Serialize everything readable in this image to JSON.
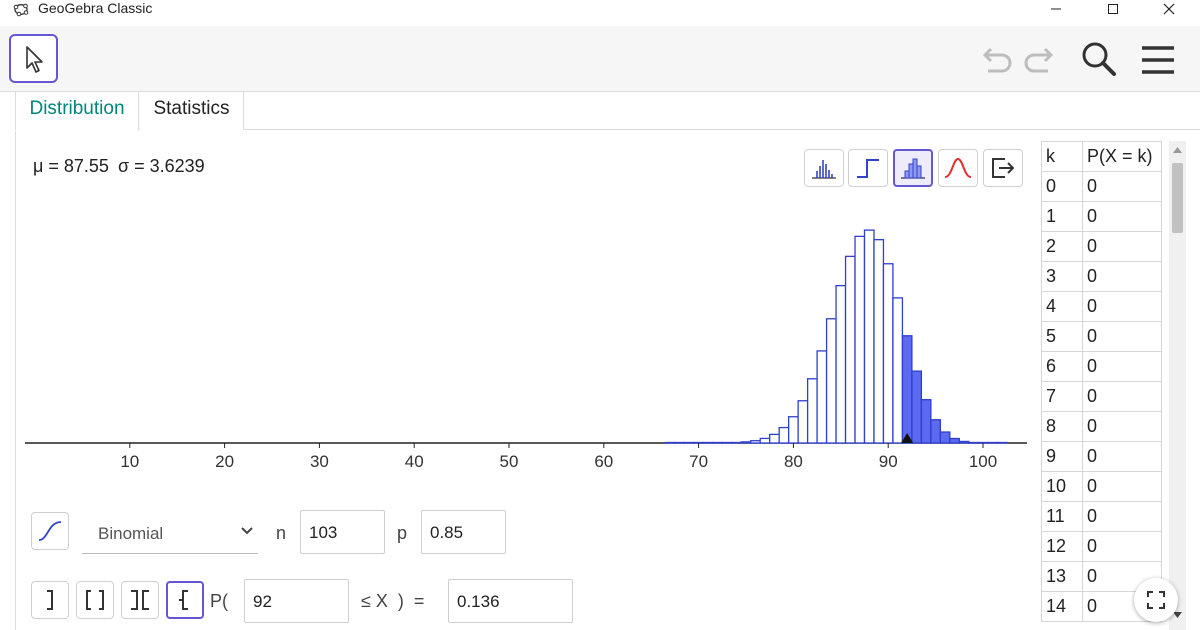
{
  "window": {
    "title": "GeoGebra Classic"
  },
  "tabs": [
    {
      "label": "Distribution",
      "active": true
    },
    {
      "label": "Statistics",
      "active": false
    }
  ],
  "stats": {
    "mean": "μ = 87.55",
    "sd": "σ = 3.6239"
  },
  "distribution": {
    "selected": "Binomial",
    "n_label": "n",
    "n_value": "103",
    "p_label": "p",
    "p_value": "0.85"
  },
  "probability": {
    "prefix": "P(",
    "bound": "92",
    "relation": "≤ X  )  =",
    "result": "0.136"
  },
  "table": {
    "headers": [
      "k",
      "P(X = k)"
    ],
    "rows": [
      [
        "0",
        "0"
      ],
      [
        "1",
        "0"
      ],
      [
        "2",
        "0"
      ],
      [
        "3",
        "0"
      ],
      [
        "4",
        "0"
      ],
      [
        "5",
        "0"
      ],
      [
        "6",
        "0"
      ],
      [
        "7",
        "0"
      ],
      [
        "8",
        "0"
      ],
      [
        "9",
        "0"
      ],
      [
        "10",
        "0"
      ],
      [
        "11",
        "0"
      ],
      [
        "12",
        "0"
      ],
      [
        "13",
        "0"
      ],
      [
        "14",
        "0"
      ]
    ]
  },
  "colors": {
    "accent": "#6557d2",
    "bar": "#2f3fd0",
    "bar_fill": "#5b6af0",
    "tab_active": "#00867a"
  },
  "chart_data": {
    "type": "bar",
    "x_ticks": [
      10,
      20,
      30,
      40,
      50,
      60,
      70,
      80,
      90,
      100
    ],
    "xlim": [
      0,
      104
    ],
    "ylim": [
      0,
      0.11
    ],
    "grid": false,
    "n": 103,
    "p": 0.85,
    "shade_from": 92,
    "shade_to": 103,
    "marker_at": 92
  }
}
